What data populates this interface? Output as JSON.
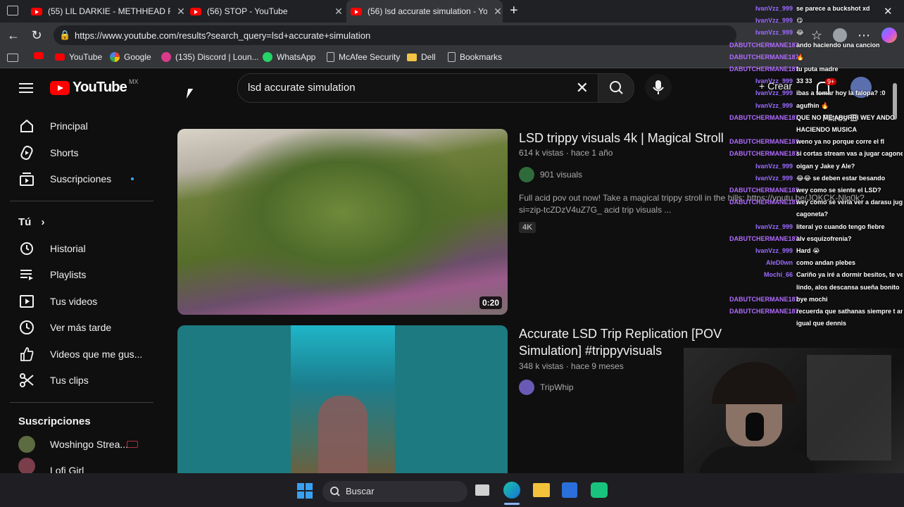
{
  "browser": {
    "tabs": [
      {
        "title": "(55) LIL DARKIE - METHHEAD FRE",
        "active": false
      },
      {
        "title": "(56) STOP - YouTube",
        "active": false
      },
      {
        "title": "(56) lsd accurate simulation - You",
        "active": true
      }
    ],
    "new_tab": "+",
    "close_window": "✕",
    "url": "https://www.youtube.com/results?search_query=lsd+accurate+simulation",
    "bookmarks": [
      "YouTube",
      "Google",
      "(135) Discord | Loun...",
      "WhatsApp",
      "McAfee Security",
      "Dell",
      "Bookmarks"
    ]
  },
  "youtube": {
    "logo_text": "YouTube",
    "region": "MX",
    "search_query": "lsd accurate simulation",
    "clear_glyph": "✕",
    "header_right": {
      "create_label": "Crear",
      "filters_label": "Filtros",
      "notification_count": "9+"
    },
    "sidebar": {
      "main": [
        "Principal",
        "Shorts",
        "Suscripciones"
      ],
      "you_heading": "Tú",
      "you_chevron": "›",
      "you_items": [
        "Historial",
        "Playlists",
        "Tus videos",
        "Ver más tarde",
        "Videos que me gus...",
        "Tus clips"
      ],
      "subs_heading": "Suscripciones",
      "subs_items": [
        "Woshingo Strea...",
        "Lofi Girl"
      ]
    },
    "results": [
      {
        "title": "LSD trippy visuals 4k | Magical Stroll",
        "meta": "614 k vistas · hace 1 año",
        "channel": "901 visuals",
        "description": "Full acid pov out now! Take a magical trippy stroll in the hills: https://youtu.be/JQKCK-Nlq0k?si=zip-tcZDzV4uZ7G_ acid trip visuals ...",
        "badge": "4K",
        "duration": "0:20"
      },
      {
        "title": "Accurate LSD Trip Replication [POV Simulation] #trippyvisuals",
        "meta": "348 k vistas · hace 9 meses",
        "channel": "TripWhip"
      }
    ]
  },
  "chat": [
    {
      "user": "IvanVzz_999",
      "msg": "se parece a buckshot xd",
      "style": "green"
    },
    {
      "user": "IvanVzz_999",
      "msg": "😋",
      "style": "green"
    },
    {
      "user": "IvanVzz_999",
      "msg": "😂",
      "style": "green"
    },
    {
      "user": "DABUTCHERMANE187",
      "msg": "ando haciendo una cancion",
      "style": "purple"
    },
    {
      "user": "DABUTCHERMANE187",
      "msg": "🔥",
      "style": "purple"
    },
    {
      "user": "DABUTCHERMANE187",
      "msg": "tu puta madre",
      "style": "purple"
    },
    {
      "user": "IvanVzz_999",
      "msg": "33 33",
      "style": "green"
    },
    {
      "user": "IvanVzz_999",
      "msg": "ibas a tomar hoy la falopa? :0",
      "style": "green"
    },
    {
      "user": "IvanVzz_999",
      "msg": "agufhin 🔥",
      "style": "green"
    },
    {
      "user": "DABUTCHERMANE187",
      "msg": "QUE NO ME ABURRI WEY ANDO",
      "style": "purple"
    },
    {
      "user": "",
      "msg": "HACIENDO MUSICA",
      "style": "purple"
    },
    {
      "user": "DABUTCHERMANE187",
      "msg": "weno ya no porque corre el fl",
      "style": "purple"
    },
    {
      "user": "DABUTCHERMANE187",
      "msg": "si cortas stream vas a jugar cagoneta",
      "style": "purple"
    },
    {
      "user": "IvanVzz_999",
      "msg": "oigan y Jake y Ale?",
      "style": "green"
    },
    {
      "user": "IvanVzz_999",
      "msg": "😂😂 se deben estar besando",
      "style": "green"
    },
    {
      "user": "DABUTCHERMANE187",
      "msg": "wey como se siente el LSD?",
      "style": "purple"
    },
    {
      "user": "DABUTCHERMANE187",
      "msg": "wey como se veria ver a darasu jugando",
      "style": "purple"
    },
    {
      "user": "",
      "msg": "cagoneta?",
      "style": "purple"
    },
    {
      "user": "IvanVzz_999",
      "msg": "literal yo cuando tengo fiebre",
      "style": "green"
    },
    {
      "user": "DABUTCHERMANE187",
      "msg": "alv esquizofrenia?",
      "style": "purple"
    },
    {
      "user": "IvanVzz_999",
      "msg": "Hard 😭",
      "style": "green"
    },
    {
      "user": "AleD0wn",
      "msg": "como andan plebes",
      "style": "green"
    },
    {
      "user": "Mochi_66",
      "msg": "Cariño ya iré a dormir besitos, te vez muy",
      "style": "green"
    },
    {
      "user": "",
      "msg": "lindo, alos descansa sueña bonito",
      "style": "green"
    },
    {
      "user": "DABUTCHERMANE187",
      "msg": "bye mochi",
      "style": "purple"
    },
    {
      "user": "DABUTCHERMANE187",
      "msg": "recuerda que sathanas siempre t amara",
      "style": "purple"
    },
    {
      "user": "",
      "msg": "igual que dennis",
      "style": "purple"
    }
  ],
  "taskbar": {
    "search_label": "Buscar"
  },
  "colors": {
    "yt_red": "#ff0000",
    "bg": "#0f0f0f",
    "accent_blue": "#3ea6ff"
  }
}
